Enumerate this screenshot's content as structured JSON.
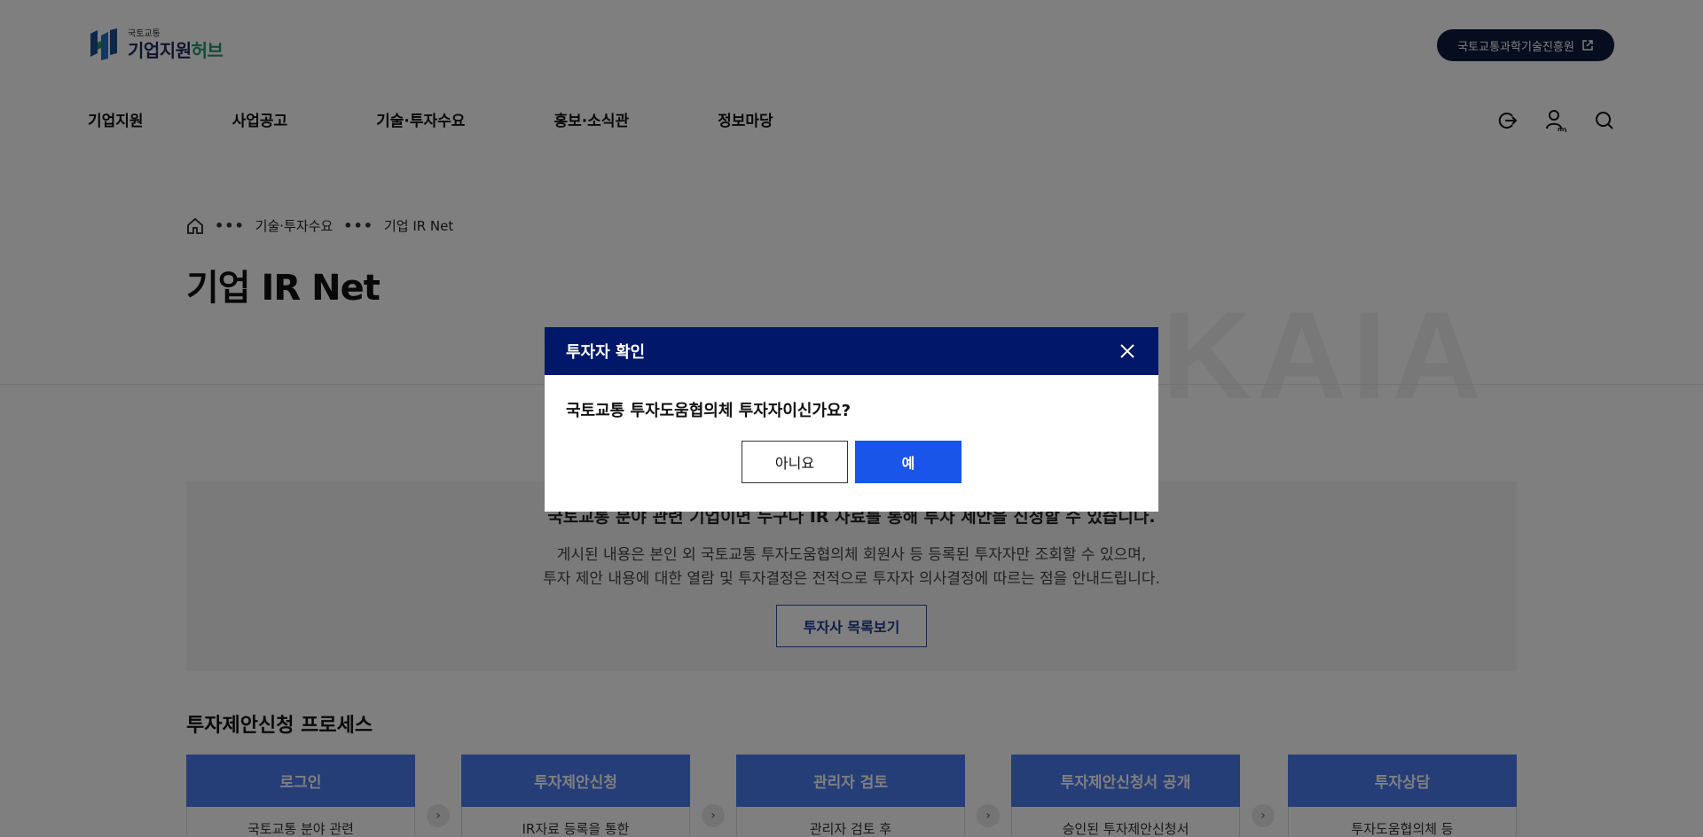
{
  "header": {
    "logo_sub": "국토교통",
    "logo_main": "기업지원",
    "logo_accent": "허브",
    "external_link_label": "국토교통과학기술진흥원",
    "nav": [
      "기업지원",
      "사업공고",
      "기술·투자수요",
      "홍보·소식관",
      "정보마당"
    ],
    "utility_icons": [
      "logout-icon",
      "my-page-icon",
      "search-icon"
    ]
  },
  "breadcrumb": {
    "items": [
      "기술·투자수요",
      "기업 IR Net"
    ]
  },
  "page_title": "기업 IR Net",
  "watermark": "KAIA",
  "notice": {
    "headline": "국토교통 분야 관련 기업이면 누구나 IR 자료를 통해 투자 제안을 신청할 수 있습니다.",
    "line1": "게시된 내용은 본인 외 국토교통 투자도움협의체 회원사 등 등록된 투자자만 조회할 수 있으며,",
    "line2": "투자 제안 내용에 대한 열람 및 투자결정은 전적으로 투자자 의사결정에 따르는 점을 안내드립니다.",
    "button_label": "투자사 목록보기"
  },
  "process": {
    "title": "투자제안신청 프로세스",
    "steps": [
      {
        "title": "로그인",
        "desc": "국토교통 분야 관련"
      },
      {
        "title": "투자제안신청",
        "desc": "IR자료 등록을 통한"
      },
      {
        "title": "관리자 검토",
        "desc": "관리자 검토 후"
      },
      {
        "title": "투자제안신청서 공개",
        "desc": "승인된 투자제안신청서"
      },
      {
        "title": "투자상담",
        "desc": "투자도움협의체 등"
      }
    ]
  },
  "modal": {
    "title": "투자자 확인",
    "question": "국토교통 투자도움협의체 투자자이신가요?",
    "no_label": "아니요",
    "yes_label": "예"
  },
  "colors": {
    "modal_header": "#011769",
    "primary_button": "#1855e8",
    "step_header": "#4a7cf0",
    "external_button": "#0b1b3d",
    "logo_accent": "#1f9a6f"
  }
}
